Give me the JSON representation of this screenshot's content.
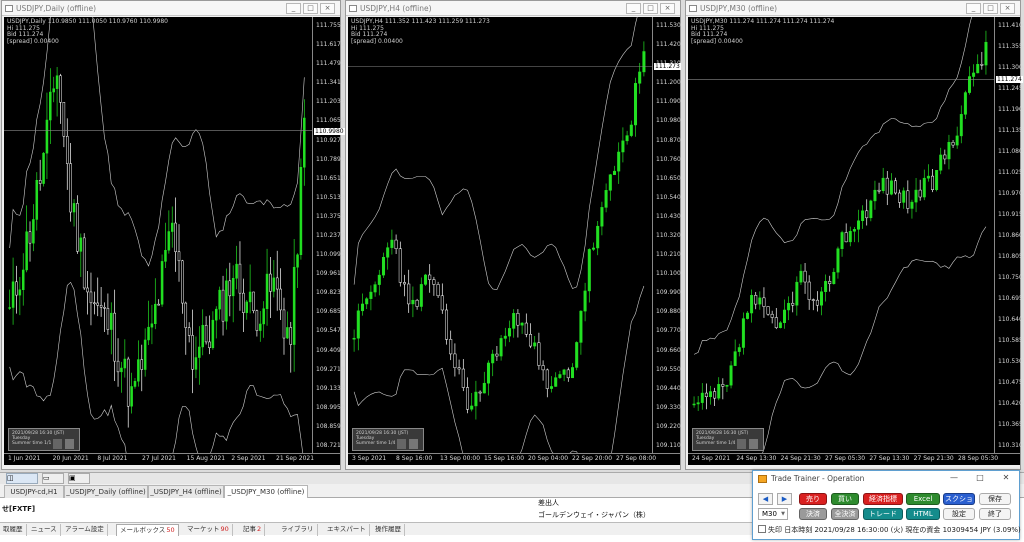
{
  "colors": {
    "bull": "#22e022",
    "bear": "#ffffff",
    "band": "#d0d0d0",
    "sell": "#d92020",
    "buy": "#2e8b2e",
    "blue": "#2a5fd0",
    "teal": "#148c8c",
    "gray": "#9a9a9a",
    "white_btn": "#f4f4f4"
  },
  "charts": [
    {
      "title": "USDJPY,Daily (offline)",
      "header": "USDJPY,Daily  110.9850 111.0050 110.9760 110.9980",
      "info_lines": [
        "Hi 111.275",
        "Bid 111.274",
        "[spread] 0.00400"
      ],
      "y_labels": [
        "111.7550",
        "111.6170",
        "111.4790",
        "111.3410",
        "111.2030",
        "111.0650",
        "110.9270",
        "110.7890",
        "110.6510",
        "110.5130",
        "110.3750",
        "110.2370",
        "110.0990",
        "109.9610",
        "109.8230",
        "109.6850",
        "109.5470",
        "109.4090",
        "109.2710",
        "109.1330",
        "108.9950",
        "108.8590",
        "108.7210"
      ],
      "price_box": "110.9980",
      "x_labels": [
        "1 Jun 2021",
        "20 Jun 2021",
        "8 Jul 2021",
        "27 Jul 2021",
        "15 Aug 2021",
        "2 Sep 2021",
        "21 Sep 2021"
      ],
      "box_text": [
        "2021/09/28 16:30 (JST)",
        "Tuesday",
        "Summer time    1/1"
      ],
      "ymin": 108.72,
      "ymax": 111.8,
      "last": 110.998,
      "n": 88,
      "anchors": [
        [
          0,
          109.7
        ],
        [
          6,
          110.3
        ],
        [
          10,
          110.8
        ],
        [
          14,
          111.45
        ],
        [
          18,
          110.5
        ],
        [
          24,
          109.8
        ],
        [
          30,
          109.6
        ],
        [
          36,
          109.1
        ],
        [
          42,
          109.6
        ],
        [
          48,
          110.3
        ],
        [
          54,
          109.4
        ],
        [
          60,
          109.6
        ],
        [
          66,
          110.0
        ],
        [
          72,
          109.7
        ],
        [
          78,
          109.9
        ],
        [
          83,
          109.5
        ],
        [
          87,
          111.0
        ]
      ],
      "vol": 0.2,
      "seed": 11,
      "bbw": 0.7
    },
    {
      "title": "USDJPY,H4 (offline)",
      "header": "USDJPY,H4  111.352 111.423 111.259 111.273",
      "info_lines": [
        "Hi 111.275",
        "Bid 111.274",
        "[spread] 0.00400"
      ],
      "y_labels": [
        "111.530",
        "111.420",
        "111.310",
        "111.200",
        "111.090",
        "110.980",
        "110.870",
        "110.760",
        "110.650",
        "110.540",
        "110.430",
        "110.320",
        "110.210",
        "110.100",
        "109.990",
        "109.880",
        "109.770",
        "109.660",
        "109.550",
        "109.440",
        "109.330",
        "109.220",
        "109.110"
      ],
      "price_box": "111.273",
      "x_labels": [
        "3 Sep 2021",
        "8 Sep 16:00",
        "13 Sep 00:00",
        "15 Sep 16:00",
        "20 Sep 04:00",
        "22 Sep 20:00",
        "27 Sep 08:00"
      ],
      "box_text": [
        "2021/09/28 16:30 (JST)",
        "Tuesday",
        "Summer time    1/4"
      ],
      "ymin": 109.11,
      "ymax": 111.55,
      "last": 111.273,
      "n": 70,
      "anchors": [
        [
          0,
          109.8
        ],
        [
          6,
          110.1
        ],
        [
          9,
          110.35
        ],
        [
          13,
          109.9
        ],
        [
          18,
          110.1
        ],
        [
          24,
          109.6
        ],
        [
          28,
          109.35
        ],
        [
          34,
          109.7
        ],
        [
          40,
          109.9
        ],
        [
          46,
          109.45
        ],
        [
          52,
          109.6
        ],
        [
          56,
          110.2
        ],
        [
          62,
          110.7
        ],
        [
          66,
          111.0
        ],
        [
          69,
          111.35
        ]
      ],
      "vol": 0.08,
      "seed": 23,
      "bbw": 0.5
    },
    {
      "title": "USDJPY,M30 (offline)",
      "header": "USDJPY,M30  111.274 111.274 111.274 111.274",
      "info_lines": [
        "Hi 111.275",
        "Bid 111.274",
        "[spread] 0.00400"
      ],
      "y_labels": [
        "111.410",
        "111.355",
        "111.300",
        "111.245",
        "111.190",
        "111.135",
        "111.080",
        "111.025",
        "110.970",
        "110.915",
        "110.860",
        "110.805",
        "110.750",
        "110.695",
        "110.640",
        "110.585",
        "110.530",
        "110.475",
        "110.420",
        "110.365",
        "110.310"
      ],
      "price_box": "111.274",
      "x_labels": [
        "24 Sep 2021",
        "24 Sep 13:30",
        "24 Sep 21:30",
        "27 Sep 05:30",
        "27 Sep 13:30",
        "27 Sep 21:30",
        "28 Sep 05:30"
      ],
      "box_text": [
        "2021/09/28 16:30 (JST)",
        "Tuesday",
        "Summer time    1/4"
      ],
      "ymin": 110.28,
      "ymax": 111.44,
      "last": 111.274,
      "n": 72,
      "anchors": [
        [
          0,
          110.4
        ],
        [
          8,
          110.45
        ],
        [
          14,
          110.7
        ],
        [
          20,
          110.6
        ],
        [
          26,
          110.75
        ],
        [
          30,
          110.65
        ],
        [
          36,
          110.85
        ],
        [
          40,
          110.9
        ],
        [
          46,
          111.0
        ],
        [
          52,
          110.95
        ],
        [
          58,
          111.0
        ],
        [
          64,
          111.15
        ],
        [
          68,
          111.3
        ],
        [
          71,
          111.35
        ]
      ],
      "vol": 0.035,
      "seed": 37,
      "bbw": 0.22
    }
  ],
  "win_buttons": [
    "_",
    "□",
    "×"
  ],
  "strip": {
    "items": [
      "◫",
      "▭",
      "▣",
      "▢"
    ]
  },
  "symbol_tabs": [
    "USDJPY-cd,H1",
    "_USDJPY_Daily (offline)",
    "_USDJPY_H4 (offline)",
    "_USDJPY_M30 (offline)"
  ],
  "panel": {
    "header": "差出人",
    "sender": "ゴールデンウェイ・ジャパン（株）",
    "left_label": "せ[FXTF]"
  },
  "bottom_tabs": [
    {
      "label": "取履歴"
    },
    {
      "label": "ニュース"
    },
    {
      "label": "アラーム設定"
    },
    {
      "label": "メールボックス",
      "badge": "50"
    },
    {
      "label": "マーケット",
      "badge": "90"
    },
    {
      "label": "記事",
      "badge": "2"
    },
    {
      "label": "ライブラリ"
    },
    {
      "label": "エキスパート"
    },
    {
      "label": "操作履歴"
    }
  ],
  "trainer": {
    "title": "Trade Trainer - Operation",
    "ctl": [
      "—",
      "□",
      "✕"
    ],
    "row1": [
      {
        "label": "◀",
        "kind": "arrow"
      },
      {
        "label": "▶",
        "kind": "arrow"
      },
      {
        "label": "売り",
        "kind": "sell"
      },
      {
        "label": "買い",
        "kind": "buy"
      },
      {
        "label": "経済指標",
        "kind": "sell"
      },
      {
        "label": "Excel",
        "kind": "buy"
      },
      {
        "label": "スクショ",
        "kind": "blue"
      },
      {
        "label": "保存",
        "kind": "white"
      }
    ],
    "row2": [
      {
        "label": "決済",
        "kind": "gray"
      },
      {
        "label": "全決済",
        "kind": "gray"
      },
      {
        "label": "トレード",
        "kind": "teal"
      },
      {
        "label": "HTML",
        "kind": "teal"
      },
      {
        "label": "設定",
        "kind": "white"
      },
      {
        "label": "終了",
        "kind": "white"
      }
    ],
    "timeframe": "M30",
    "status": "失印   日本時刻 2021/09/28 16:30:00 (火)   現在の資金 10309454 JPY (3.09%)"
  }
}
